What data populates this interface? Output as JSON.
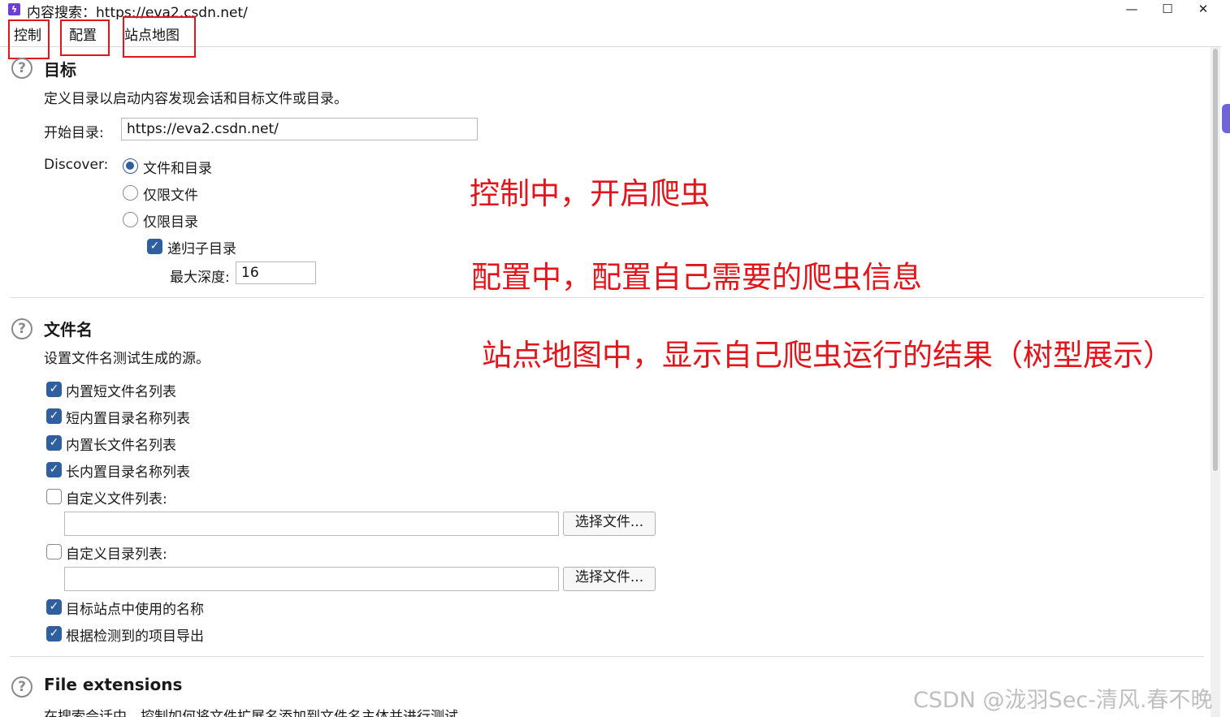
{
  "window": {
    "title": "内容搜索：https://eva2.csdn.net/",
    "app_icon": "lightning-app-icon",
    "controls": {
      "minimize": "—",
      "maximize": "☐",
      "close": "✕"
    }
  },
  "tabs": [
    {
      "label": "控制"
    },
    {
      "label": "配置"
    },
    {
      "label": "站点地图"
    }
  ],
  "target": {
    "title": "目标",
    "description": "定义目录以启动内容发现会话和目标文件或目录。",
    "start_dir_label": "开始目录:",
    "start_dir_value": "https://eva2.csdn.net/",
    "discover_label": "Discover:",
    "options": [
      {
        "label": "文件和目录",
        "selected": true
      },
      {
        "label": "仅限文件",
        "selected": false
      },
      {
        "label": "仅限目录",
        "selected": false
      }
    ],
    "recurse_label": "递归子目录",
    "recurse_checked": true,
    "max_depth_label": "最大深度:",
    "max_depth_value": "16"
  },
  "filenames": {
    "title": "文件名",
    "description": "设置文件名测试生成的源。",
    "items": [
      {
        "label": "内置短文件名列表",
        "checked": true
      },
      {
        "label": "短内置目录名称列表",
        "checked": true
      },
      {
        "label": "内置长文件名列表",
        "checked": true
      },
      {
        "label": "长内置目录名称列表",
        "checked": true
      },
      {
        "label": "自定义文件列表:",
        "checked": false
      },
      {
        "label": "自定义目录列表:",
        "checked": false
      },
      {
        "label": "目标站点中使用的名称",
        "checked": true
      },
      {
        "label": "根据检测到的项目导出",
        "checked": true
      }
    ],
    "choose_file_label": "选择文件..."
  },
  "file_extensions": {
    "title": "File extensions",
    "description": "在搜索会话中，控制如何将文件扩展名添加到文件名主体并进行测试"
  },
  "annotations": {
    "line1": "控制中，开启爬虫",
    "line2": "配置中，配置自己需要的爬虫信息",
    "line3": "站点地图中，显示自己爬虫运行的结果（树型展示）",
    "color": "#e3141a"
  },
  "watermark": "CSDN @泷羽Sec-清风.春不晚",
  "colors": {
    "accent": "#2f5f9e",
    "annotation_red": "#e3141a"
  }
}
